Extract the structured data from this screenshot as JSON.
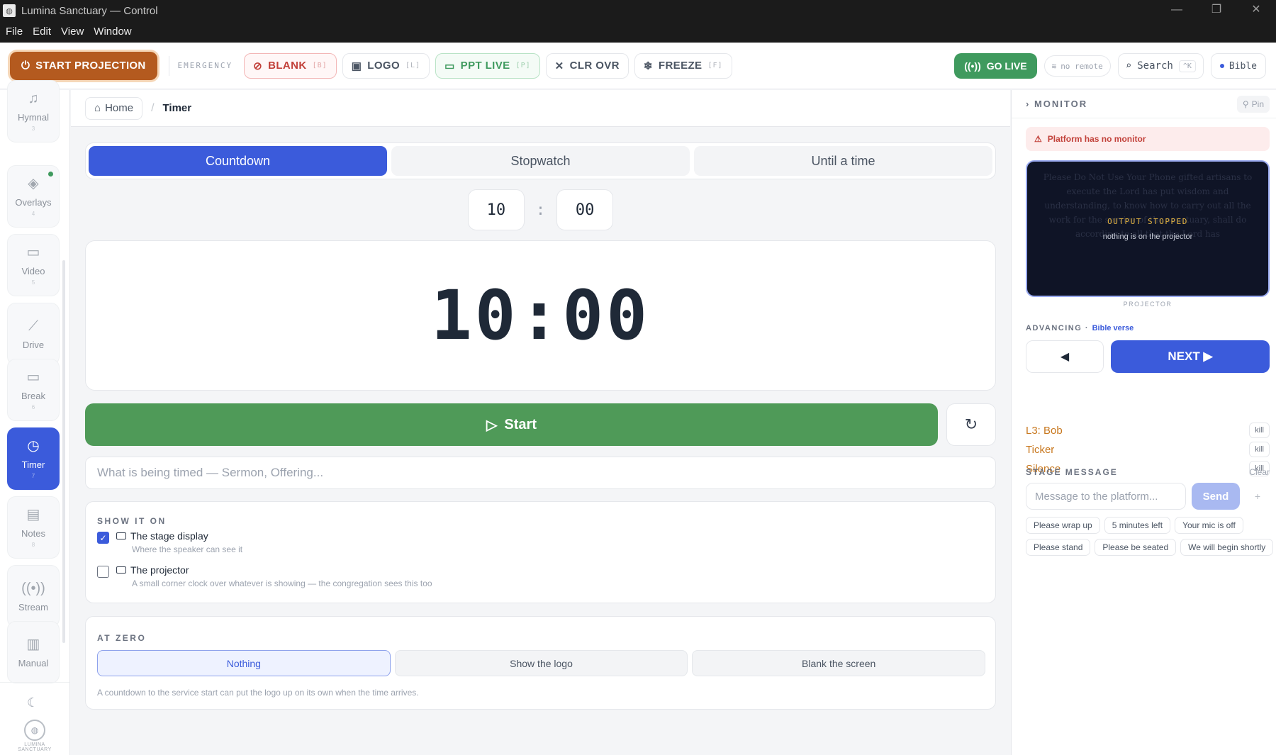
{
  "window": {
    "title": "Lumina Sanctuary — Control",
    "controls": [
      "—",
      "❐",
      "✕"
    ]
  },
  "menu": [
    "File",
    "Edit",
    "View",
    "Window"
  ],
  "toolbar": {
    "start_projection": "START PROJECTION",
    "emergency_label": "EMERGENCY",
    "blank": {
      "label": "BLANK",
      "key": "[B]"
    },
    "logo": {
      "label": "LOGO",
      "key": "[L]"
    },
    "ppt_live": {
      "label": "PPT LIVE",
      "key": "[P]"
    },
    "clr_ovr": {
      "label": "CLR OVR"
    },
    "freeze": {
      "label": "FREEZE",
      "key": "[F]"
    },
    "go_live": "GO LIVE",
    "no_remote": "no remote",
    "search": {
      "label": "Search",
      "kbd": "^K"
    },
    "bible": "Bible",
    "colors": {
      "start": "#b45a1f",
      "blank": "#c2413a",
      "ppt": "#3f9a5e",
      "go_live": "#3f9a5e"
    }
  },
  "sidebar": {
    "items": [
      {
        "label": "Hymnal",
        "num": "3",
        "icon": "music-note-icon"
      },
      {
        "label": "Overlays",
        "num": "4",
        "icon": "layers-icon",
        "badge": true
      },
      {
        "label": "Video",
        "num": "5",
        "icon": "video-camera-icon"
      },
      {
        "label": "Drive",
        "num": "",
        "icon": "drive-icon"
      },
      {
        "label": "Break",
        "num": "6",
        "icon": "monitor-icon"
      },
      {
        "label": "Timer",
        "num": "7",
        "icon": "clock-icon",
        "active": true
      },
      {
        "label": "Notes",
        "num": "8",
        "icon": "notes-icon"
      },
      {
        "label": "Stream",
        "num": "",
        "icon": "broadcast-icon"
      },
      {
        "label": "Manual",
        "num": "",
        "icon": "book-icon"
      }
    ],
    "logo_text": "LUMINA SANCTUARY"
  },
  "breadcrumb": {
    "home": "Home",
    "separator": "/",
    "current": "Timer"
  },
  "timer": {
    "tabs": [
      "Countdown",
      "Stopwatch",
      "Until a time"
    ],
    "active_tab": 0,
    "minutes": "10",
    "seconds": "00",
    "colon": ":",
    "display": "10:00",
    "start_label": "Start",
    "label_placeholder": "What is being timed — Sermon, Offering...",
    "show_it_on": {
      "title": "SHOW IT ON",
      "options": [
        {
          "label": "The stage display",
          "desc": "Where the speaker can see it",
          "checked": true
        },
        {
          "label": "The projector",
          "desc": "A small corner clock over whatever is showing — the congregation sees this too",
          "checked": false
        }
      ]
    },
    "at_zero": {
      "title": "AT ZERO",
      "options": [
        "Nothing",
        "Show the logo",
        "Blank the screen"
      ],
      "active": 0,
      "note": "A countdown to the service start can put the logo up on its own when the time arrives."
    }
  },
  "monitor": {
    "title": "MONITOR",
    "pin": "Pin",
    "alert": "Platform has no monitor",
    "preview": {
      "ghost_text": "Please Do Not Use Your Phone gifted artisans to execute the Lord has put wisdom and understanding, to know how to carry out all the work for the service of the sanctuary, shall do according to all that the Lord has",
      "status": "OUTPUT STOPPED",
      "sub": "nothing is on the projector"
    },
    "caption": "PROJECTOR",
    "advancing_label": "ADVANCING",
    "advancing_dot": "·",
    "advancing_source": "Bible verse",
    "prev": "◀",
    "next": "NEXT ▶",
    "kill_rows": [
      {
        "name": "L3: Bob",
        "kill": "kill"
      },
      {
        "name": "Ticker",
        "kill": "kill"
      },
      {
        "name": "Silence",
        "kill": "kill"
      }
    ],
    "stage_message": {
      "title": "STAGE MESSAGE",
      "clear": "Clear",
      "placeholder": "Message to the platform...",
      "send": "Send",
      "plus": "+",
      "chips": [
        "Please wrap up",
        "5 minutes left",
        "Your mic is off",
        "Please stand",
        "Please be seated",
        "We will begin shortly"
      ]
    }
  }
}
